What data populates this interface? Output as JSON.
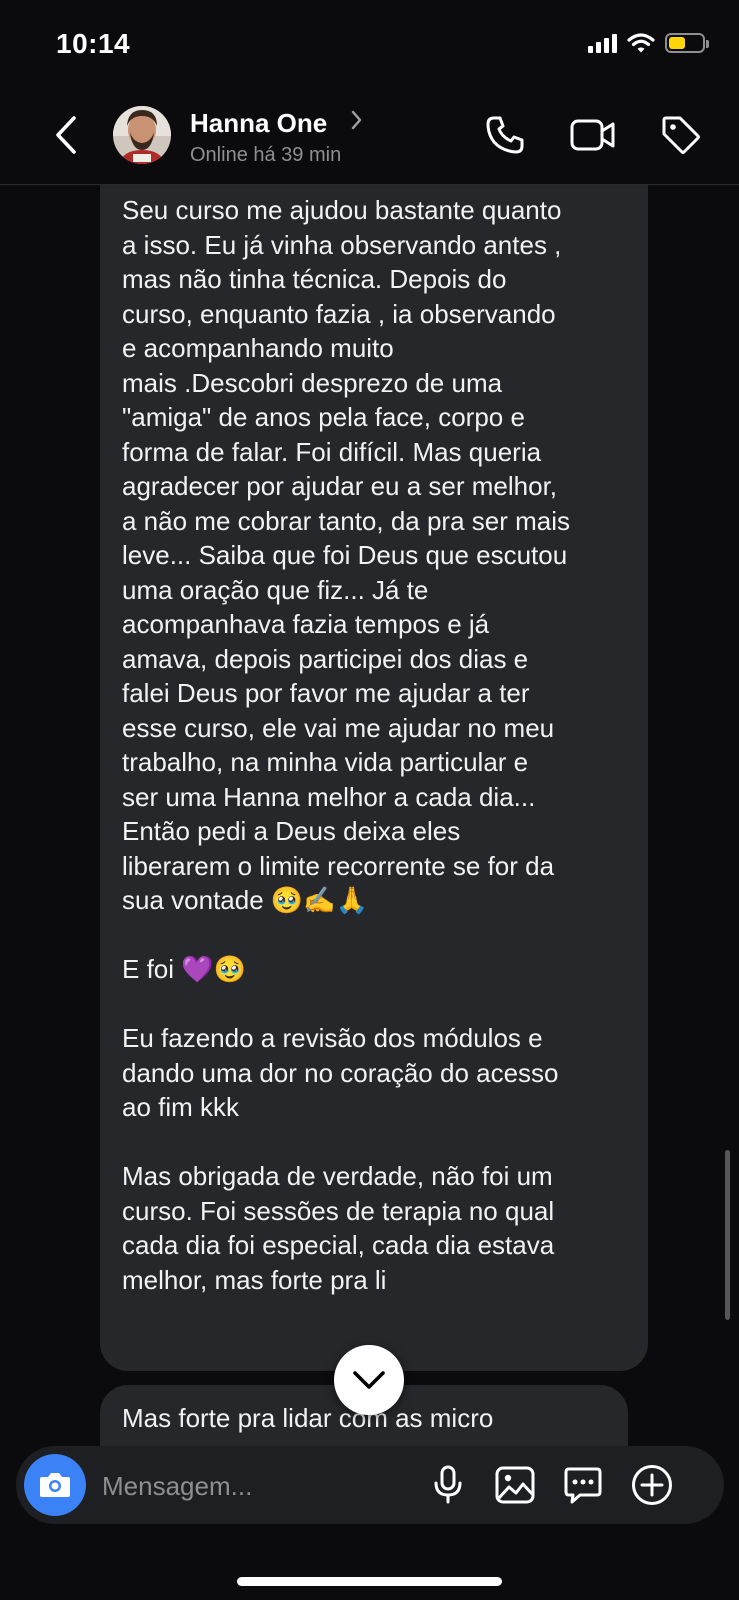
{
  "status_bar": {
    "time": "10:14",
    "icons": [
      "cellular-signal-icon",
      "wifi-icon",
      "battery-icon"
    ],
    "battery_level": 0.5,
    "battery_color": "#FFD60A"
  },
  "header": {
    "contact_name": "Hanna One",
    "contact_status": "Online há 39 min",
    "icons": [
      "back-chevron-icon",
      "phone-icon",
      "video-camera-icon",
      "tag-icon"
    ]
  },
  "messages": [
    {
      "sender": "contact",
      "text": "Seu curso me ajudou bastante quanto\na isso. Eu já vinha observando antes ,\nmas não tinha técnica. Depois do\ncurso, enquanto fazia , ia observando\ne acompanhando muito\nmais .Descobri desprezo de uma\n\"amiga\" de anos pela face, corpo e\nforma de falar. Foi difícil. Mas queria\nagradecer por ajudar eu a ser melhor,\na não me cobrar tanto, da pra ser mais\nleve... Saiba que foi Deus que escutou\numa oração que fiz... Já te\nacompanhava fazia tempos e já\namava, depois participei dos dias e\nfalei Deus por favor me ajudar a ter\nesse curso, ele vai me ajudar no meu\ntrabalho, na minha vida particular e\nser uma Hanna melhor a cada dia...\nEntão pedi a Deus deixa eles\nliberarem o limite recorrente se for da\nsua vontade  🥹✍️🙏\n\nE foi 💜🥹\n\nEu fazendo a revisão dos módulos e\ndando uma dor no coração do acesso\nao fim kkk\n\nMas obrigada de verdade, não foi um\ncurso. Foi sessões de terapia no qual\ncada dia foi especial, cada dia estava\nmelhor, mas forte pra li"
    },
    {
      "sender": "contact",
      "text": "Mas forte pra lidar com as micro"
    }
  ],
  "composer": {
    "placeholder": "Mensagem...",
    "icons": [
      "camera-icon",
      "microphone-icon",
      "image-icon",
      "sticker-chat-icon",
      "add-icon"
    ],
    "camera_color": "#3B82F6"
  },
  "colors": {
    "background": "#0B0B0D",
    "bubble": "#26272B",
    "secondary_text": "#8E8E93"
  }
}
